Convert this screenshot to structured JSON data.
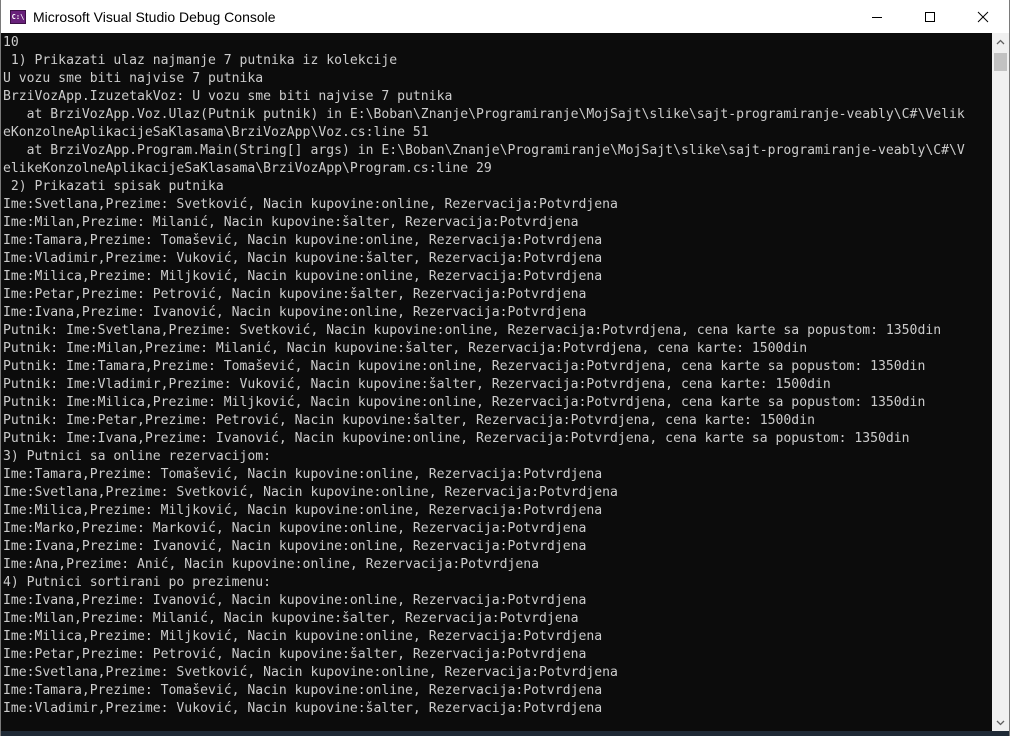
{
  "window": {
    "title": "Microsoft Visual Studio Debug Console",
    "icon": "vs-debug-console-icon",
    "icon_text": "C:\\"
  },
  "controls": {
    "minimize": "minimize-icon",
    "maximize": "maximize-icon",
    "close": "close-icon"
  },
  "console": {
    "lines": [
      "10",
      " 1) Prikazati ulaz najmanje 7 putnika iz kolekcije",
      "U vozu sme biti najvise 7 putnika",
      "BrziVozApp.IzuzetakVoz: U vozu sme biti najvise 7 putnika",
      "   at BrziVozApp.Voz.Ulaz(Putnik putnik) in E:\\Boban\\Znanje\\Programiranje\\MojSajt\\slike\\sajt-programiranje-veably\\C#\\Velik",
      "eKonzolneAplikacijeSaKlasama\\BrziVozApp\\Voz.cs:line 51",
      "   at BrziVozApp.Program.Main(String[] args) in E:\\Boban\\Znanje\\Programiranje\\MojSajt\\slike\\sajt-programiranje-veably\\C#\\V",
      "elikeKonzolneAplikacijeSaKlasama\\BrziVozApp\\Program.cs:line 29",
      " 2) Prikazati spisak putnika",
      "Ime:Svetlana,Prezime: Svetković, Nacin kupovine:online, Rezervacija:Potvrdjena",
      "Ime:Milan,Prezime: Milanić, Nacin kupovine:šalter, Rezervacija:Potvrdjena",
      "Ime:Tamara,Prezime: Tomašević, Nacin kupovine:online, Rezervacija:Potvrdjena",
      "Ime:Vladimir,Prezime: Vuković, Nacin kupovine:šalter, Rezervacija:Potvrdjena",
      "Ime:Milica,Prezime: Miljković, Nacin kupovine:online, Rezervacija:Potvrdjena",
      "Ime:Petar,Prezime: Petrović, Nacin kupovine:šalter, Rezervacija:Potvrdjena",
      "Ime:Ivana,Prezime: Ivanović, Nacin kupovine:online, Rezervacija:Potvrdjena",
      "Putnik: Ime:Svetlana,Prezime: Svetković, Nacin kupovine:online, Rezervacija:Potvrdjena, cena karte sa popustom: 1350din",
      "Putnik: Ime:Milan,Prezime: Milanić, Nacin kupovine:šalter, Rezervacija:Potvrdjena, cena karte: 1500din",
      "Putnik: Ime:Tamara,Prezime: Tomašević, Nacin kupovine:online, Rezervacija:Potvrdjena, cena karte sa popustom: 1350din",
      "Putnik: Ime:Vladimir,Prezime: Vuković, Nacin kupovine:šalter, Rezervacija:Potvrdjena, cena karte: 1500din",
      "Putnik: Ime:Milica,Prezime: Miljković, Nacin kupovine:online, Rezervacija:Potvrdjena, cena karte sa popustom: 1350din",
      "Putnik: Ime:Petar,Prezime: Petrović, Nacin kupovine:šalter, Rezervacija:Potvrdjena, cena karte: 1500din",
      "Putnik: Ime:Ivana,Prezime: Ivanović, Nacin kupovine:online, Rezervacija:Potvrdjena, cena karte sa popustom: 1350din",
      "3) Putnici sa online rezervacijom:",
      "Ime:Tamara,Prezime: Tomašević, Nacin kupovine:online, Rezervacija:Potvrdjena",
      "Ime:Svetlana,Prezime: Svetković, Nacin kupovine:online, Rezervacija:Potvrdjena",
      "Ime:Milica,Prezime: Miljković, Nacin kupovine:online, Rezervacija:Potvrdjena",
      "Ime:Marko,Prezime: Marković, Nacin kupovine:online, Rezervacija:Potvrdjena",
      "Ime:Ivana,Prezime: Ivanović, Nacin kupovine:online, Rezervacija:Potvrdjena",
      "Ime:Ana,Prezime: Anić, Nacin kupovine:online, Rezervacija:Potvrdjena",
      "4) Putnici sortirani po prezimenu:",
      "Ime:Ivana,Prezime: Ivanović, Nacin kupovine:online, Rezervacija:Potvrdjena",
      "Ime:Milan,Prezime: Milanić, Nacin kupovine:šalter, Rezervacija:Potvrdjena",
      "Ime:Milica,Prezime: Miljković, Nacin kupovine:online, Rezervacija:Potvrdjena",
      "Ime:Petar,Prezime: Petrović, Nacin kupovine:šalter, Rezervacija:Potvrdjena",
      "Ime:Svetlana,Prezime: Svetković, Nacin kupovine:online, Rezervacija:Potvrdjena",
      "Ime:Tamara,Prezime: Tomašević, Nacin kupovine:online, Rezervacija:Potvrdjena",
      "Ime:Vladimir,Prezime: Vuković, Nacin kupovine:šalter, Rezervacija:Potvrdjena"
    ]
  },
  "colors": {
    "console_background": "#0c0c0c",
    "console_text": "#cccccc",
    "titlebar_background": "#ffffff",
    "app_icon": "#68217a"
  }
}
